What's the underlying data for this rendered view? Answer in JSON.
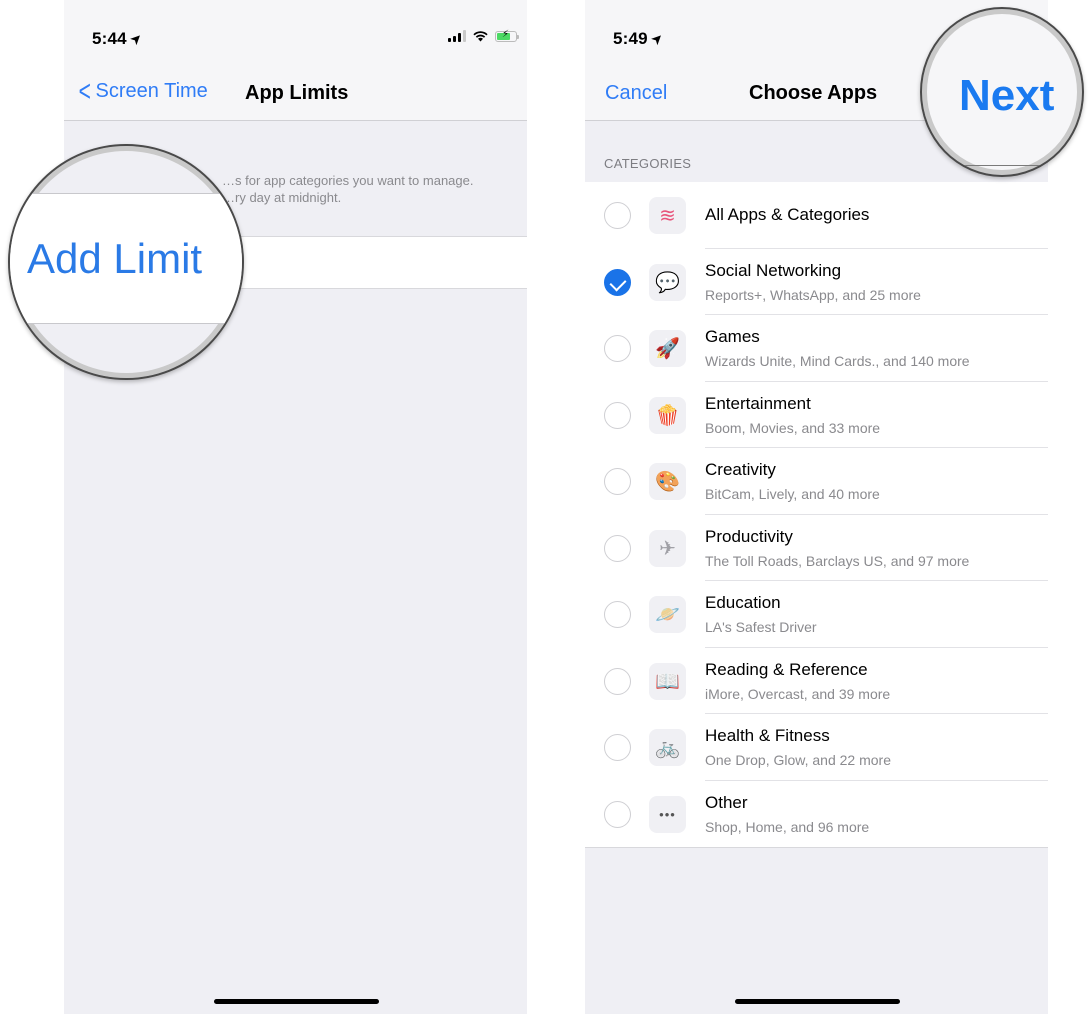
{
  "left_screen": {
    "status_bar": {
      "time": "5:44",
      "location_icon": "location-arrow-icon",
      "signal_icon": "cellular-signal-icon",
      "wifi_icon": "wifi-icon",
      "battery_icon": "battery-charging-icon"
    },
    "nav": {
      "back_label": "Screen Time",
      "title": "App Limits"
    },
    "footer_text_line1": "…s for app categories you want to manage.",
    "footer_text_line2": "…ry day at midnight.",
    "magnifier": {
      "label": "Add Limit"
    }
  },
  "right_screen": {
    "status_bar": {
      "time": "5:49",
      "location_icon": "location-arrow-icon"
    },
    "nav": {
      "cancel_label": "Cancel",
      "title": "Choose Apps",
      "next_label": "Next"
    },
    "section_header": "CATEGORIES",
    "categories": [
      {
        "title": "All Apps & Categories",
        "subtitle": "",
        "icon": "stack-icon",
        "glyph": "≋",
        "color": "#e8537a",
        "checked": false
      },
      {
        "title": "Social Networking",
        "subtitle": "Reports+, WhatsApp, and 25 more",
        "icon": "chat-bubbles-icon",
        "glyph": "💬",
        "color": "#e8366d",
        "checked": true
      },
      {
        "title": "Games",
        "subtitle": "Wizards Unite, Mind Cards., and 140 more",
        "icon": "rocket-icon",
        "glyph": "🚀",
        "color": "#4aa8e8",
        "checked": false
      },
      {
        "title": "Entertainment",
        "subtitle": "Boom, Movies, and 33 more",
        "icon": "popcorn-icon",
        "glyph": "🍿",
        "color": "#e8455a",
        "checked": false
      },
      {
        "title": "Creativity",
        "subtitle": "BitCam, Lively, and 40 more",
        "icon": "palette-icon",
        "glyph": "🎨",
        "color": "#f0b020",
        "checked": false
      },
      {
        "title": "Productivity",
        "subtitle": "The Toll Roads, Barclays US, and 97 more",
        "icon": "paper-plane-icon",
        "glyph": "✈",
        "color": "#a0a0a6",
        "checked": false
      },
      {
        "title": "Education",
        "subtitle": "LA's Safest Driver",
        "icon": "planet-icon",
        "glyph": "🪐",
        "color": "#f0a030",
        "checked": false
      },
      {
        "title": "Reading & Reference",
        "subtitle": "iMore, Overcast, and 39 more",
        "icon": "book-icon",
        "glyph": "📖",
        "color": "#4aa0d0",
        "checked": false
      },
      {
        "title": "Health & Fitness",
        "subtitle": "One Drop, Glow, and 22 more",
        "icon": "bicycle-icon",
        "glyph": "🚲",
        "color": "#4ab0e0",
        "checked": false
      },
      {
        "title": "Other",
        "subtitle": "Shop, Home, and 96 more",
        "icon": "more-dots-icon",
        "glyph": "•••",
        "color": "#555555",
        "checked": false
      }
    ]
  },
  "colors": {
    "accent": "#2f7cf6",
    "checked": "#1a73e8",
    "background": "#efeff4"
  }
}
